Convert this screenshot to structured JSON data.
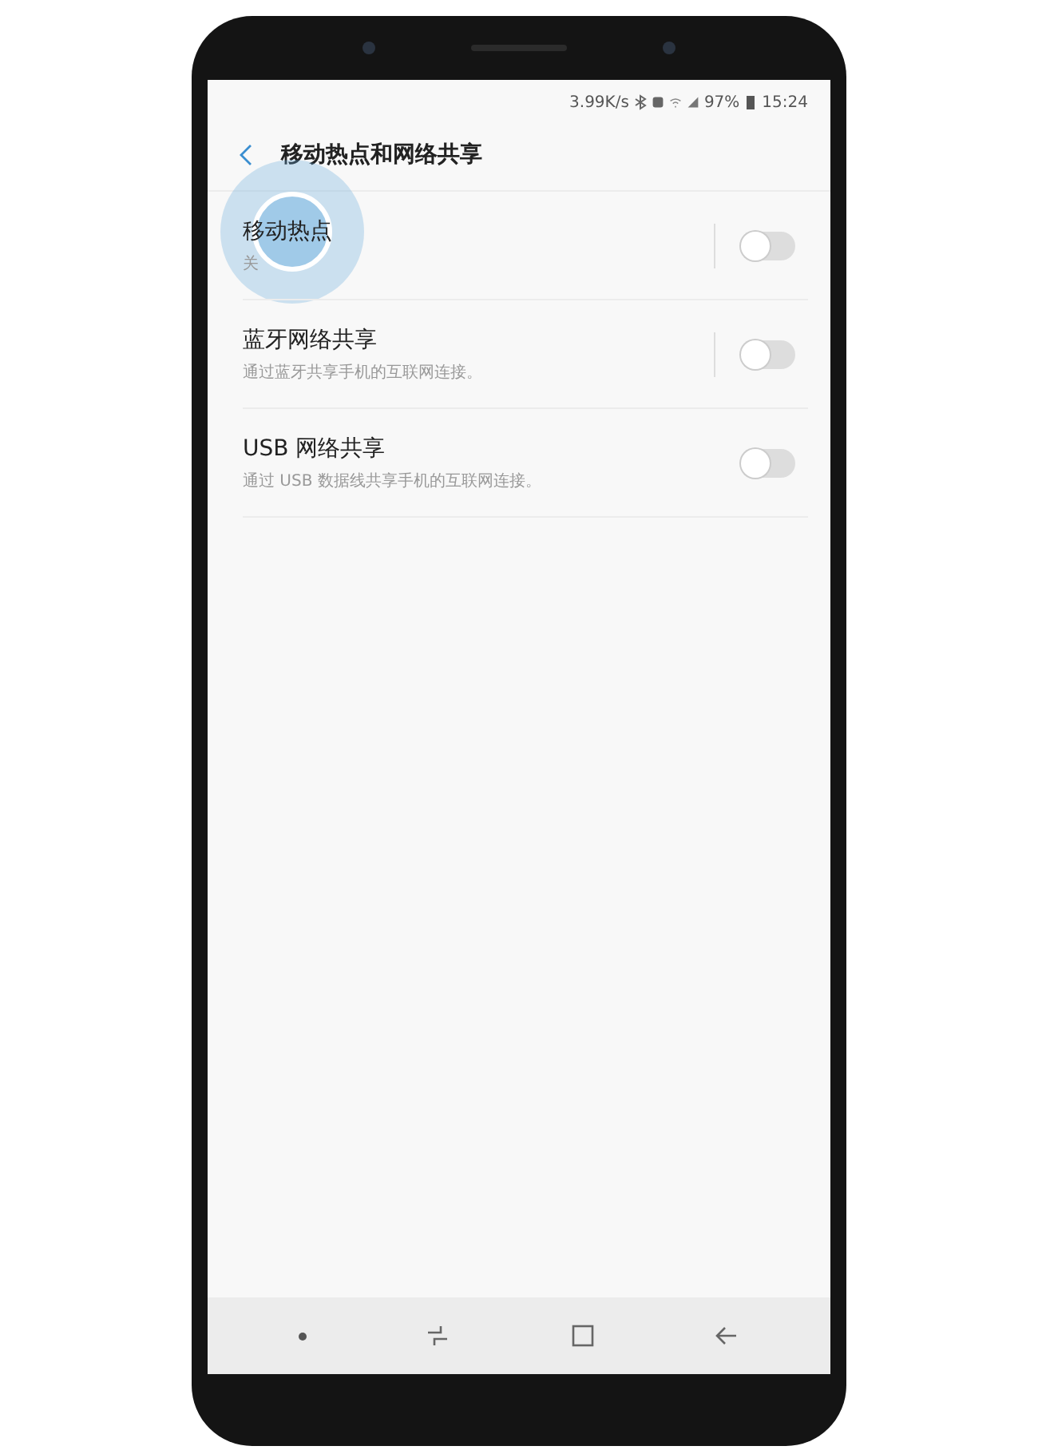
{
  "status_bar": {
    "speed": "3.99K/s",
    "battery": "97%",
    "time": "15:24"
  },
  "header": {
    "title": "移动热点和网络共享"
  },
  "items": [
    {
      "title": "移动热点",
      "subtitle": "关",
      "on": false,
      "split": true
    },
    {
      "title": "蓝牙网络共享",
      "subtitle": "通过蓝牙共享手机的互联网连接。",
      "on": false,
      "split": true
    },
    {
      "title": "USB 网络共享",
      "subtitle": "通过 USB 数据线共享手机的互联网连接。",
      "on": false,
      "split": false
    }
  ],
  "tap_indicator": true
}
